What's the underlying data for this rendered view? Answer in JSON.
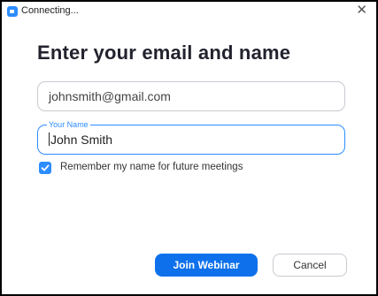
{
  "window": {
    "title": "Connecting...",
    "close_glyph": "✕"
  },
  "heading": "Enter your email and name",
  "email_field": {
    "value": "johnsmith@gmail.com"
  },
  "name_field": {
    "label": "Your Name",
    "value": "John Smith"
  },
  "remember": {
    "checked": true,
    "label": "Remember my name for future meetings"
  },
  "buttons": {
    "join_label": "Join Webinar",
    "cancel_label": "Cancel"
  },
  "colors": {
    "accent": "#2d8cff",
    "primary_button": "#0e71eb",
    "heading_text": "#23232f"
  },
  "icons": {
    "app": "zoom-app-icon",
    "close": "close-icon",
    "check": "checkmark-icon"
  }
}
